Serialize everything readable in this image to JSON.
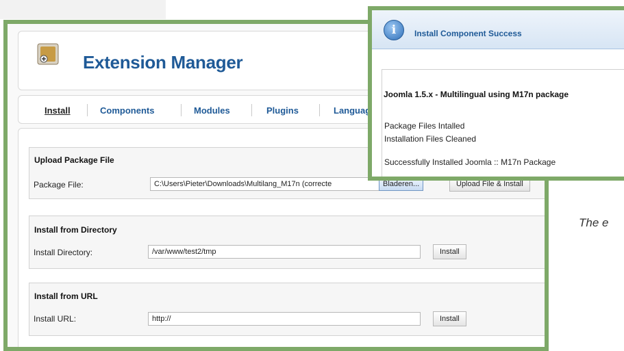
{
  "extension_manager": {
    "title": "Extension Manager",
    "tabs": [
      {
        "label": "Install",
        "active": true
      },
      {
        "label": "Components"
      },
      {
        "label": "Modules"
      },
      {
        "label": "Plugins"
      },
      {
        "label": "Languag"
      }
    ],
    "upload": {
      "title": "Upload Package File",
      "label": "Package File:",
      "value": "C:\\Users\\Pieter\\Downloads\\Multilang_M17n (correcte",
      "browse_button": "Bladeren...",
      "submit_button": "Upload File & Install"
    },
    "directory": {
      "title": "Install from Directory",
      "label": "Install Directory:",
      "value": "/var/www/test2/tmp",
      "button": "Install"
    },
    "url": {
      "title": "Install from URL",
      "label": "Install URL:",
      "value": "http://",
      "button": "Install"
    }
  },
  "success_dialog": {
    "title": "Install Component Success",
    "icon": "info-icon",
    "heading": "Joomla 1.5.x - Multilingual using M17n package",
    "lines": [
      "Package Files Intalled",
      "Installation Files Cleaned",
      "Successfully Installed Joomla :: M17n Package"
    ]
  },
  "caption": "The e",
  "colors": {
    "window_border": "#7ea968",
    "title_blue": "#1f5a97"
  }
}
